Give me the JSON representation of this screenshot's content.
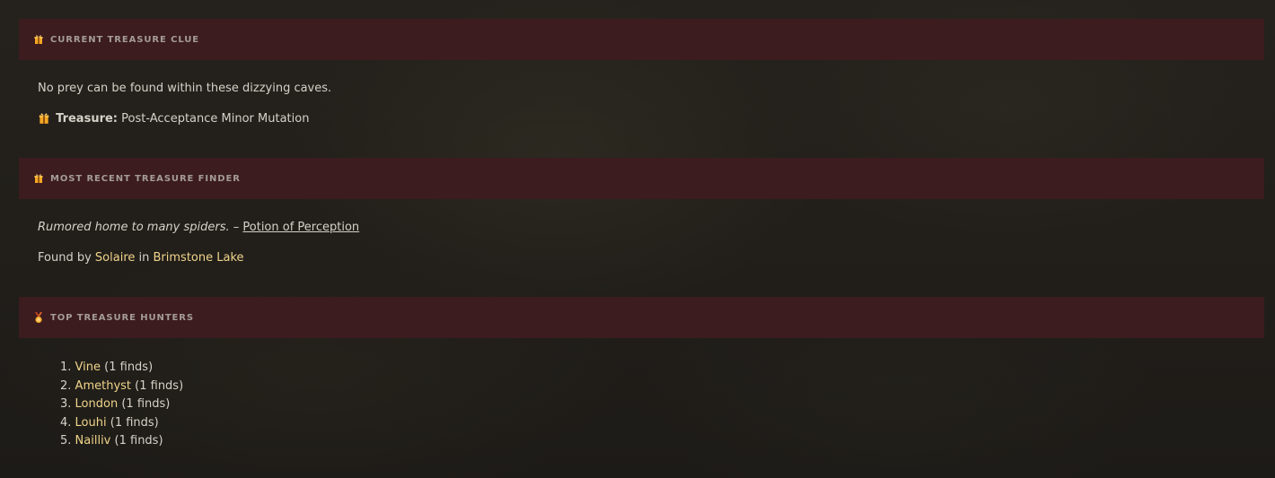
{
  "clue_section": {
    "title": "Current Treasure Clue",
    "clue_text": "No prey can be found within these dizzying caves.",
    "treasure_label": "Treasure:",
    "treasure_value": "Post-Acceptance Minor Mutation"
  },
  "finder_section": {
    "title": "Most Recent Treasure Finder",
    "rumor_text": "Rumored home to many spiders.",
    "dash": " – ",
    "item_link": "Potion of Perception",
    "found_by_label": "Found by",
    "finder_name": "Solaire",
    "in_label": "in",
    "location": "Brimstone Lake"
  },
  "hunters_section": {
    "title": "Top Treasure Hunters",
    "hunters": [
      {
        "rank": "1.",
        "name": "Vine",
        "finds": "(1 finds)"
      },
      {
        "rank": "2.",
        "name": "Amethyst",
        "finds": "(1 finds)"
      },
      {
        "rank": "3.",
        "name": "London",
        "finds": "(1 finds)"
      },
      {
        "rank": "4.",
        "name": "Louhi",
        "finds": "(1 finds)"
      },
      {
        "rank": "5.",
        "name": "Nailliv",
        "finds": "(1 finds)"
      }
    ]
  },
  "icons": {
    "header_clue": "gift-icon",
    "treasure": "gift-icon",
    "header_finder": "gift-icon",
    "header_hunters": "medal-icon"
  },
  "colors": {
    "header_bg": "#3c1c1f",
    "link_gold": "#f0d48a",
    "gift_orange": "#f5a623"
  }
}
